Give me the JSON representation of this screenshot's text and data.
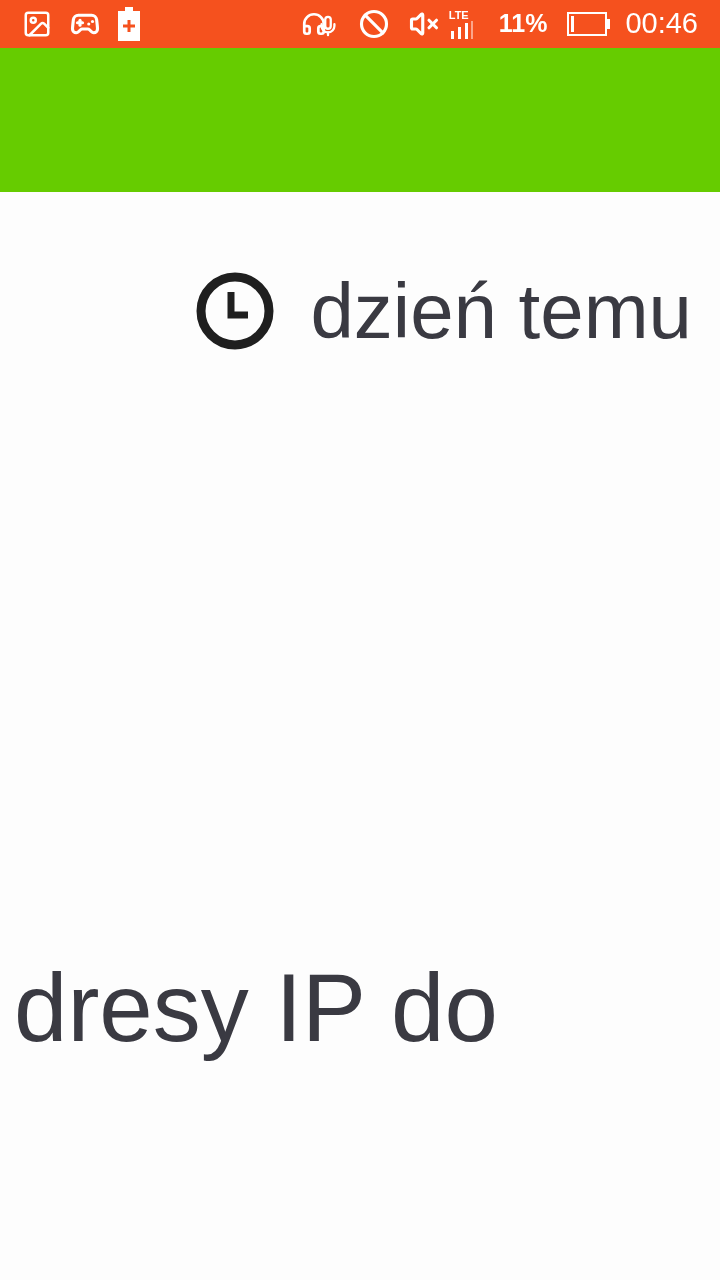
{
  "status_bar": {
    "network": "LTE",
    "battery_percent": "11%",
    "time": "00:46"
  },
  "post": {
    "time_ago": "dzień temu",
    "body_fragment": "dresy IP do"
  }
}
